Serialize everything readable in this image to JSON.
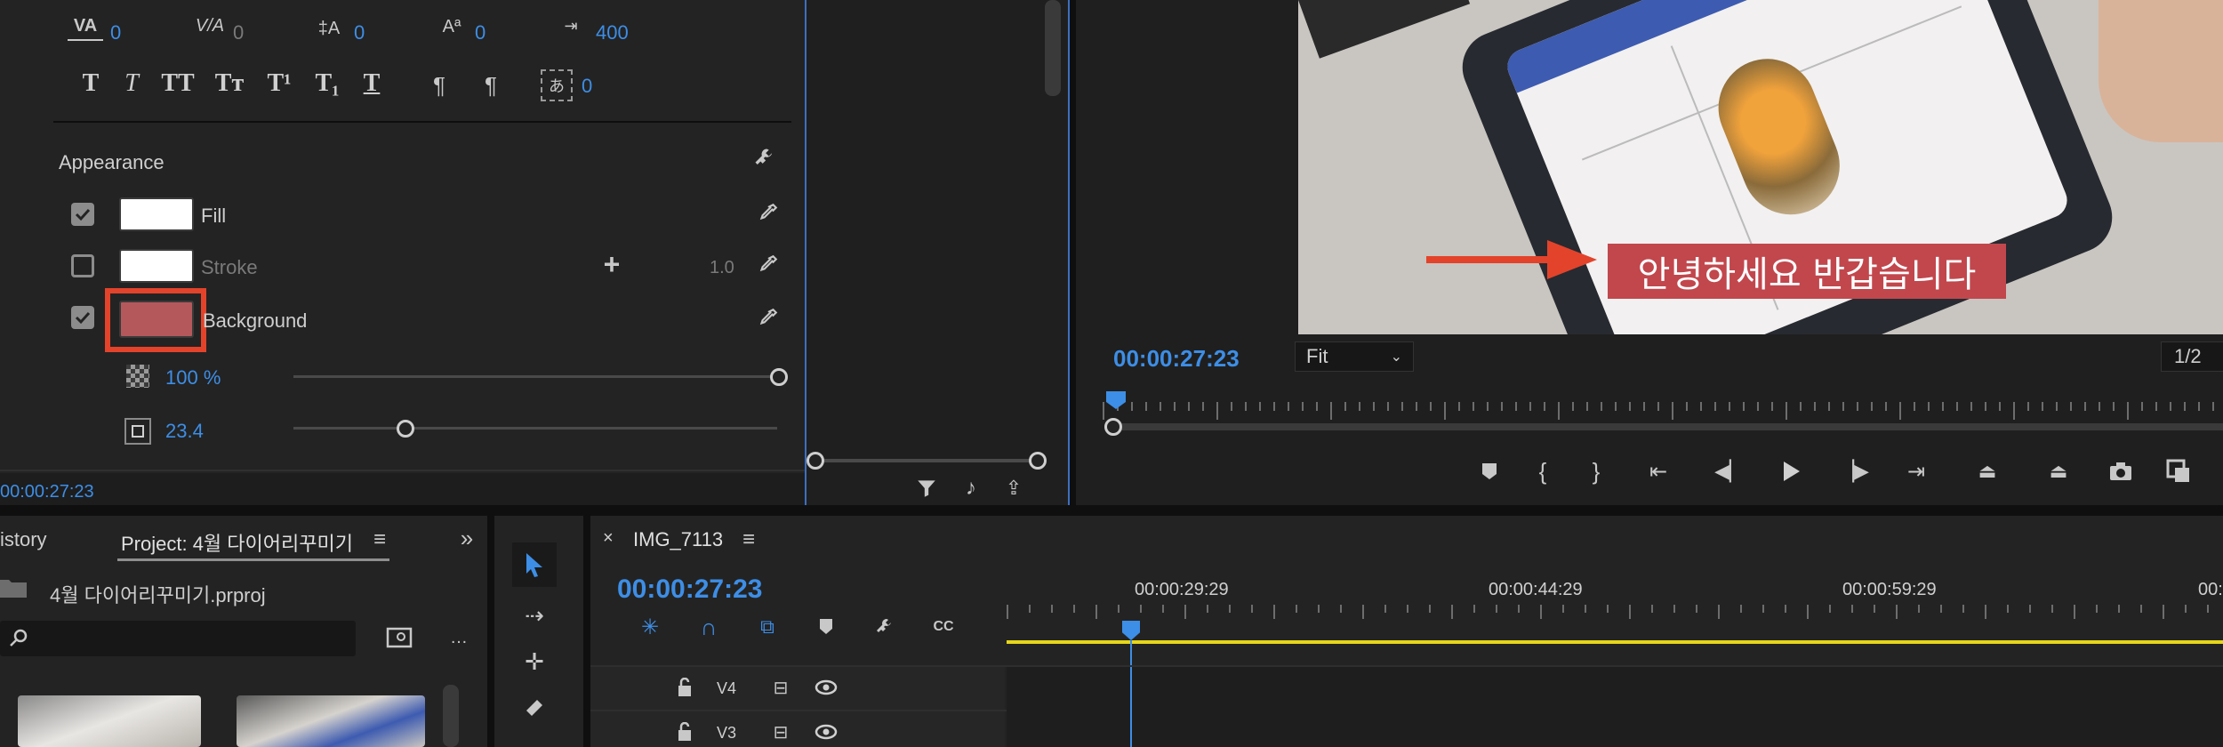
{
  "essential_graphics": {
    "text_metrics": {
      "kerning": "0",
      "tracking": "0",
      "leading": "0",
      "baseline_shift": "0",
      "tab_width": "400",
      "tsume": "0"
    },
    "style_buttons": [
      "T",
      "T",
      "TT",
      "Tт",
      "T¹",
      "T₁",
      "T"
    ],
    "appearance": {
      "title": "Appearance",
      "fill_label": "Fill",
      "stroke_label": "Stroke",
      "stroke_width": "1.0",
      "background_label": "Background",
      "background_color": "#b5585c",
      "opacity": "100 %",
      "size": "23.4"
    },
    "timecode": "00:00:27:23"
  },
  "program_monitor": {
    "timecode": "00:00:27:23",
    "zoom": "Fit",
    "resolution": "1/2",
    "caption": "안녕하세요 반갑습니다",
    "caption_bg": "#c1474d",
    "arrow_color": "#e3432b"
  },
  "project_panel": {
    "history_tab": "istory",
    "project_tab": "Project: 4월 다이어리꾸미기",
    "file_name": "4월 다이어리꾸미기.prproj",
    "search_placeholder": ""
  },
  "timeline": {
    "sequence_name": "IMG_7113",
    "timecode": "00:00:27:23",
    "ruler_labels": [
      "00:00:29:29",
      "00:00:44:29",
      "00:00:59:29",
      "00:0"
    ],
    "tracks": [
      "V4",
      "V3"
    ]
  },
  "colors": {
    "accent": "#3d8ee6",
    "highlight_box": "#e3432b",
    "work_area": "#e6d619"
  }
}
